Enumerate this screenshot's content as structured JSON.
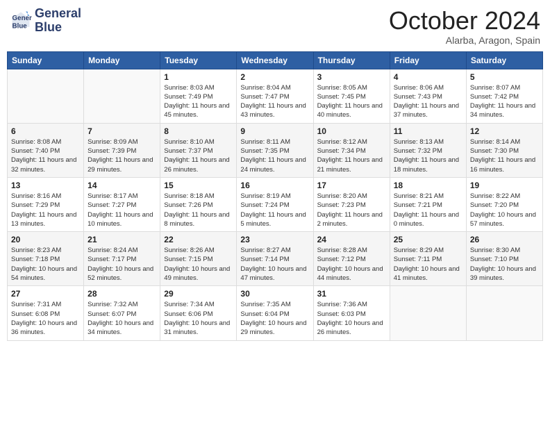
{
  "logo": {
    "line1": "General",
    "line2": "Blue"
  },
  "header": {
    "month": "October 2024",
    "location": "Alarba, Aragon, Spain"
  },
  "weekdays": [
    "Sunday",
    "Monday",
    "Tuesday",
    "Wednesday",
    "Thursday",
    "Friday",
    "Saturday"
  ],
  "weeks": [
    [
      {
        "day": "",
        "content": ""
      },
      {
        "day": "",
        "content": ""
      },
      {
        "day": "1",
        "content": "Sunrise: 8:03 AM\nSunset: 7:49 PM\nDaylight: 11 hours and 45 minutes."
      },
      {
        "day": "2",
        "content": "Sunrise: 8:04 AM\nSunset: 7:47 PM\nDaylight: 11 hours and 43 minutes."
      },
      {
        "day": "3",
        "content": "Sunrise: 8:05 AM\nSunset: 7:45 PM\nDaylight: 11 hours and 40 minutes."
      },
      {
        "day": "4",
        "content": "Sunrise: 8:06 AM\nSunset: 7:43 PM\nDaylight: 11 hours and 37 minutes."
      },
      {
        "day": "5",
        "content": "Sunrise: 8:07 AM\nSunset: 7:42 PM\nDaylight: 11 hours and 34 minutes."
      }
    ],
    [
      {
        "day": "6",
        "content": "Sunrise: 8:08 AM\nSunset: 7:40 PM\nDaylight: 11 hours and 32 minutes."
      },
      {
        "day": "7",
        "content": "Sunrise: 8:09 AM\nSunset: 7:39 PM\nDaylight: 11 hours and 29 minutes."
      },
      {
        "day": "8",
        "content": "Sunrise: 8:10 AM\nSunset: 7:37 PM\nDaylight: 11 hours and 26 minutes."
      },
      {
        "day": "9",
        "content": "Sunrise: 8:11 AM\nSunset: 7:35 PM\nDaylight: 11 hours and 24 minutes."
      },
      {
        "day": "10",
        "content": "Sunrise: 8:12 AM\nSunset: 7:34 PM\nDaylight: 11 hours and 21 minutes."
      },
      {
        "day": "11",
        "content": "Sunrise: 8:13 AM\nSunset: 7:32 PM\nDaylight: 11 hours and 18 minutes."
      },
      {
        "day": "12",
        "content": "Sunrise: 8:14 AM\nSunset: 7:30 PM\nDaylight: 11 hours and 16 minutes."
      }
    ],
    [
      {
        "day": "13",
        "content": "Sunrise: 8:16 AM\nSunset: 7:29 PM\nDaylight: 11 hours and 13 minutes."
      },
      {
        "day": "14",
        "content": "Sunrise: 8:17 AM\nSunset: 7:27 PM\nDaylight: 11 hours and 10 minutes."
      },
      {
        "day": "15",
        "content": "Sunrise: 8:18 AM\nSunset: 7:26 PM\nDaylight: 11 hours and 8 minutes."
      },
      {
        "day": "16",
        "content": "Sunrise: 8:19 AM\nSunset: 7:24 PM\nDaylight: 11 hours and 5 minutes."
      },
      {
        "day": "17",
        "content": "Sunrise: 8:20 AM\nSunset: 7:23 PM\nDaylight: 11 hours and 2 minutes."
      },
      {
        "day": "18",
        "content": "Sunrise: 8:21 AM\nSunset: 7:21 PM\nDaylight: 11 hours and 0 minutes."
      },
      {
        "day": "19",
        "content": "Sunrise: 8:22 AM\nSunset: 7:20 PM\nDaylight: 10 hours and 57 minutes."
      }
    ],
    [
      {
        "day": "20",
        "content": "Sunrise: 8:23 AM\nSunset: 7:18 PM\nDaylight: 10 hours and 54 minutes."
      },
      {
        "day": "21",
        "content": "Sunrise: 8:24 AM\nSunset: 7:17 PM\nDaylight: 10 hours and 52 minutes."
      },
      {
        "day": "22",
        "content": "Sunrise: 8:26 AM\nSunset: 7:15 PM\nDaylight: 10 hours and 49 minutes."
      },
      {
        "day": "23",
        "content": "Sunrise: 8:27 AM\nSunset: 7:14 PM\nDaylight: 10 hours and 47 minutes."
      },
      {
        "day": "24",
        "content": "Sunrise: 8:28 AM\nSunset: 7:12 PM\nDaylight: 10 hours and 44 minutes."
      },
      {
        "day": "25",
        "content": "Sunrise: 8:29 AM\nSunset: 7:11 PM\nDaylight: 10 hours and 41 minutes."
      },
      {
        "day": "26",
        "content": "Sunrise: 8:30 AM\nSunset: 7:10 PM\nDaylight: 10 hours and 39 minutes."
      }
    ],
    [
      {
        "day": "27",
        "content": "Sunrise: 7:31 AM\nSunset: 6:08 PM\nDaylight: 10 hours and 36 minutes."
      },
      {
        "day": "28",
        "content": "Sunrise: 7:32 AM\nSunset: 6:07 PM\nDaylight: 10 hours and 34 minutes."
      },
      {
        "day": "29",
        "content": "Sunrise: 7:34 AM\nSunset: 6:06 PM\nDaylight: 10 hours and 31 minutes."
      },
      {
        "day": "30",
        "content": "Sunrise: 7:35 AM\nSunset: 6:04 PM\nDaylight: 10 hours and 29 minutes."
      },
      {
        "day": "31",
        "content": "Sunrise: 7:36 AM\nSunset: 6:03 PM\nDaylight: 10 hours and 26 minutes."
      },
      {
        "day": "",
        "content": ""
      },
      {
        "day": "",
        "content": ""
      }
    ]
  ]
}
